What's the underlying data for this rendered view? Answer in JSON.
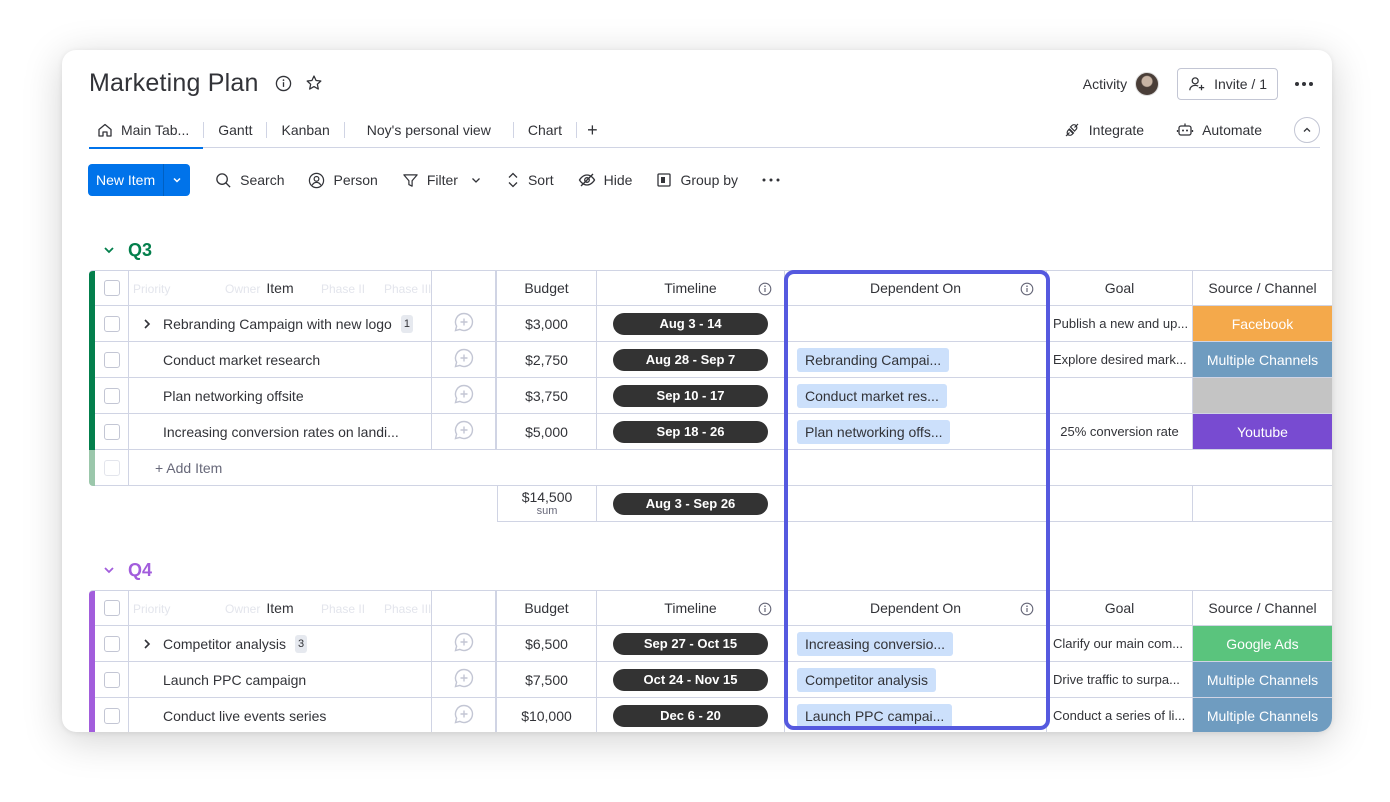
{
  "board": {
    "title": "Marketing Plan"
  },
  "header": {
    "activity_label": "Activity",
    "invite_label": "Invite / 1"
  },
  "tabs": [
    {
      "label": "Main Tab..."
    },
    {
      "label": "Gantt"
    },
    {
      "label": "Kanban"
    },
    {
      "label": "Noy's personal view"
    },
    {
      "label": "Chart"
    }
  ],
  "tab_add": "+",
  "tabs_right": {
    "integrate": "Integrate",
    "automate": "Automate"
  },
  "toolbar": {
    "new_item": "New Item",
    "search": "Search",
    "person": "Person",
    "filter": "Filter",
    "sort": "Sort",
    "hide": "Hide",
    "group_by": "Group by"
  },
  "columns": {
    "item": "Item",
    "budget": "Budget",
    "timeline": "Timeline",
    "dependent_on": "Dependent On",
    "goal": "Goal",
    "source": "Source / Channel"
  },
  "ghost_headers": [
    "Priority",
    "Owner",
    "Phase II",
    "Phase III"
  ],
  "groups": [
    {
      "name": "Q3",
      "color": "#037f4c",
      "rows": [
        {
          "item": "Rebranding Campaign with new logo",
          "count": "1",
          "budget": "$3,000",
          "timeline": "Aug 3 - 14",
          "dependent": "",
          "goal": "Publish a new and up...",
          "source": "Facebook",
          "source_color": "#f4a94b"
        },
        {
          "item": "Conduct market research",
          "count": "",
          "budget": "$2,750",
          "timeline": "Aug 28 - Sep 7",
          "dependent": "Rebranding Campai...",
          "goal": "Explore desired mark...",
          "source": "Multiple Channels",
          "source_color": "#6f9cc0"
        },
        {
          "item": "Plan networking offsite",
          "count": "",
          "budget": "$3,750",
          "timeline": "Sep 10 - 17",
          "dependent": "Conduct market res...",
          "goal": "",
          "source": "",
          "source_color": "#c4c4c4"
        },
        {
          "item": "Increasing conversion rates on landi...",
          "count": "",
          "budget": "$5,000",
          "timeline": "Sep 18 - 26",
          "dependent": "Plan networking offs...",
          "goal": "25% conversion rate",
          "source": "Youtube",
          "source_color": "#784bd1"
        }
      ],
      "add_item": "+ Add Item",
      "summary": {
        "budget": "$14,500",
        "budget_label": "sum",
        "timeline": "Aug 3 - Sep 26"
      }
    },
    {
      "name": "Q4",
      "color": "#a25ddc",
      "rows": [
        {
          "item": "Competitor analysis",
          "count": "3",
          "budget": "$6,500",
          "timeline": "Sep 27 - Oct 15",
          "dependent": "Increasing conversio...",
          "goal": "Clarify our main com...",
          "source": "Google Ads",
          "source_color": "#5ac47d"
        },
        {
          "item": "Launch PPC campaign",
          "count": "",
          "budget": "$7,500",
          "timeline": "Oct 24 - Nov 15",
          "dependent": "Competitor analysis",
          "goal": "Drive traffic to surpa...",
          "source": "Multiple Channels",
          "source_color": "#6f9cc0"
        },
        {
          "item": "Conduct live events series",
          "count": "",
          "budget": "$10,000",
          "timeline": "Dec 6 - 20",
          "dependent": "Launch PPC campai...",
          "goal": "Conduct a series of li...",
          "source": "Multiple Channels",
          "source_color": "#6f9cc0"
        }
      ]
    }
  ]
}
